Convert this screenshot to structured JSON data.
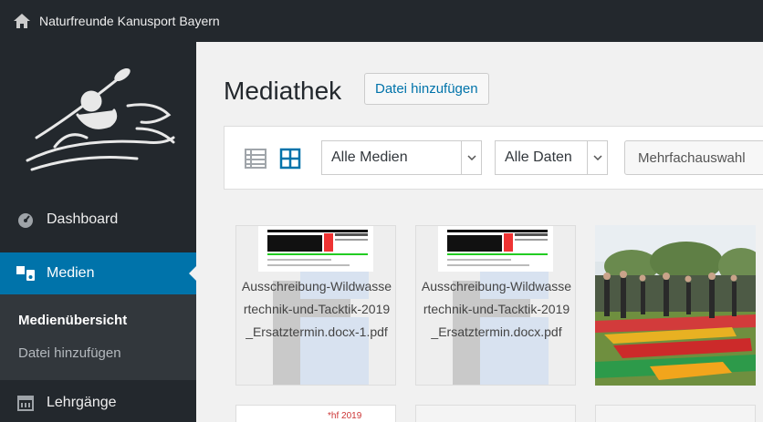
{
  "adminbar": {
    "site_name": "Naturfreunde Kanusport Bayern"
  },
  "sidebar": {
    "dashboard_label": "Dashboard",
    "medien_label": "Medien",
    "sub_overview": "Medienübersicht",
    "sub_add": "Datei hinzufügen",
    "lehrgaenge_label": "Lehrgänge"
  },
  "main": {
    "title": "Mediathek",
    "add_button": "Datei hinzufügen",
    "filter_media": "Alle Medien",
    "filter_dates": "Alle Daten",
    "bulk_select": "Mehrfachauswahl"
  },
  "media": [
    {
      "caption": "Ausschreibung-Wildwassertechnik-und-Tacktik-2019_Ersatztermin.docx-1.pdf"
    },
    {
      "caption": "Ausschreibung-Wildwassertechnik-und-Tacktik-2019_Ersatztermin.docx.pdf"
    }
  ],
  "row2": {
    "doc_label": "*hf 2019"
  },
  "colors": {
    "adminbar": "#23282d",
    "sidebar": "#23282d",
    "active": "#0073aa",
    "submenu": "#32373c",
    "background": "#f1f1f1"
  }
}
